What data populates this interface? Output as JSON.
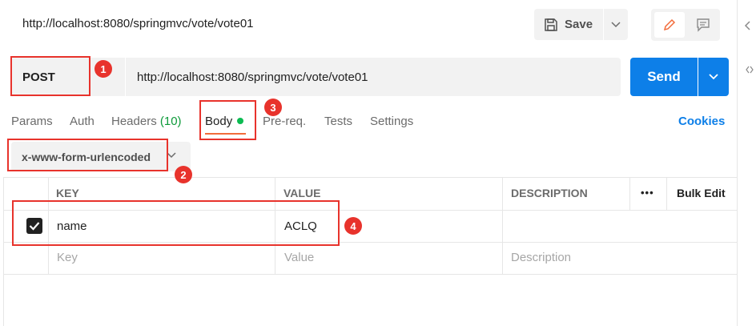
{
  "header": {
    "title": "http://localhost:8080/springmvc/vote/vote01",
    "save_label": "Save"
  },
  "request": {
    "method": "POST",
    "url": "http://localhost:8080/springmvc/vote/vote01",
    "send_label": "Send"
  },
  "tabs": [
    {
      "label": "Params"
    },
    {
      "label": "Auth"
    },
    {
      "label": "Headers",
      "count": "(10)"
    },
    {
      "label": "Body"
    },
    {
      "label": "Pre-req."
    },
    {
      "label": "Tests"
    },
    {
      "label": "Settings"
    }
  ],
  "cookies_label": "Cookies",
  "body_type": "x-www-form-urlencoded",
  "table": {
    "headers": {
      "key": "KEY",
      "value": "VALUE",
      "description": "DESCRIPTION",
      "bulk_edit": "Bulk Edit"
    },
    "rows": [
      {
        "checked": true,
        "key": "name",
        "value": "ACLQ",
        "description": ""
      }
    ],
    "placeholders": {
      "key": "Key",
      "value": "Value",
      "description": "Description"
    }
  },
  "annotations": [
    "1",
    "2",
    "3",
    "4"
  ],
  "colors": {
    "accent": "#0d7fe8",
    "annotation": "#e8332c",
    "active_tab": "#f26b3a",
    "status_dot": "#0cbb52"
  }
}
